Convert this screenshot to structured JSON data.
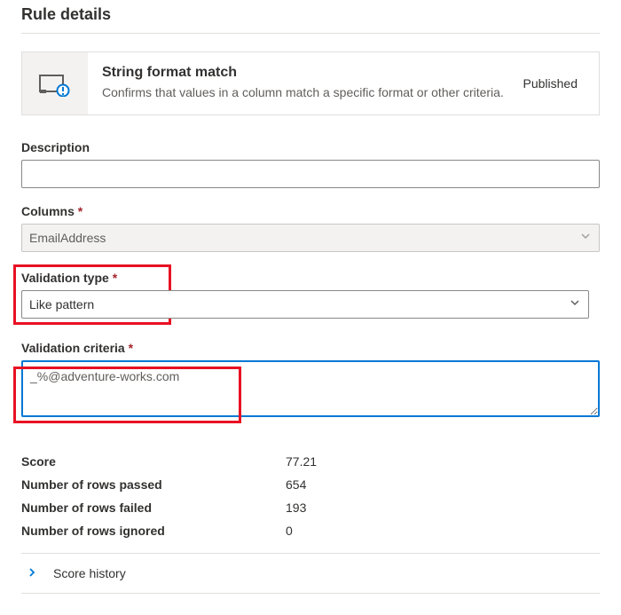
{
  "page_title": "Rule details",
  "rule": {
    "title": "String format match",
    "description": "Confirms that values in a column match a specific format or other criteria.",
    "status": "Published"
  },
  "fields": {
    "description_label": "Description",
    "description_value": "",
    "columns_label": "Columns",
    "columns_value": "EmailAddress",
    "validation_type_label": "Validation type",
    "validation_type_value": "Like pattern",
    "validation_criteria_label": "Validation criteria",
    "validation_criteria_value": "_%@adventure-works.com"
  },
  "stats": {
    "score_label": "Score",
    "score_value": "77.21",
    "rows_passed_label": "Number of rows passed",
    "rows_passed_value": "654",
    "rows_failed_label": "Number of rows failed",
    "rows_failed_value": "193",
    "rows_ignored_label": "Number of rows ignored",
    "rows_ignored_value": "0"
  },
  "history": {
    "label": "Score history"
  }
}
